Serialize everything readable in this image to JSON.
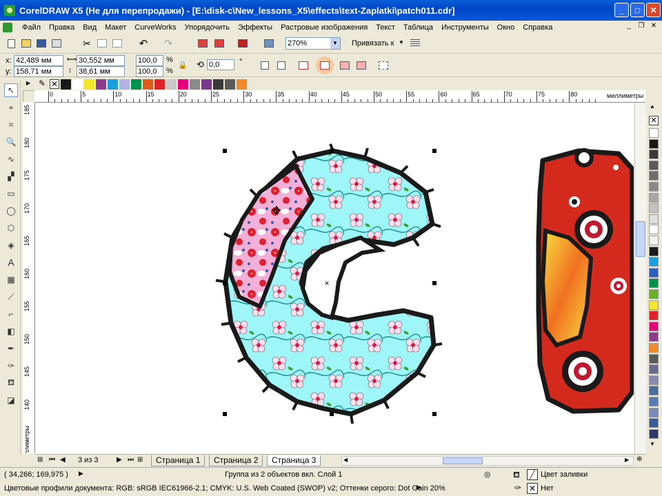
{
  "window": {
    "title": "CorelDRAW X5 (Не для перепродажи) - [E:\\disk-c\\New_lessons_X5\\effects\\text-Zaplatki\\patch011.cdr]"
  },
  "menu": {
    "items": [
      "Файл",
      "Правка",
      "Вид",
      "Макет",
      "CurveWorks",
      "Упорядочить",
      "Эффекты",
      "Растровые изображения",
      "Текст",
      "Таблица",
      "Инструменты",
      "Окно",
      "Справка"
    ]
  },
  "standard_toolbar": {
    "zoom": "270%",
    "snap_label": "Привязать к"
  },
  "property_bar": {
    "x_label": "x:",
    "x_value": "42,489 мм",
    "y_label": "y:",
    "y_value": "158,71 мм",
    "width_value": "30,552 мм",
    "height_value": "38,61 мм",
    "scale_x": "100,0",
    "scale_y": "100,0",
    "percent": "%",
    "rotation": "0,0",
    "degree": "°"
  },
  "palette_top": [
    "#1a1a1a",
    "#ffffff",
    "#f5e62a",
    "#8e3a8e",
    "#1aa0e0",
    "#b2b2e6",
    "#00924a",
    "#e05a1a",
    "#e2202a",
    "#c8c8c8",
    "#e8007a",
    "#8a8a8a",
    "#7a3a8a",
    "#3a3a3a",
    "#5a5a5a",
    "#f08a2a"
  ],
  "palette_right": [
    "#ffffff",
    "#1a1a1a",
    "#3a3a3a",
    "#5a5a5a",
    "#6e6e6e",
    "#8a8a8a",
    "#a6a6a6",
    "#c2c2c2",
    "#dedede",
    "#ffffff",
    "#f0f0f0",
    "#1a1a1a",
    "#1aa0e0",
    "#2a60c0",
    "#00924a",
    "#6ab02a",
    "#f5e62a",
    "#e2202a",
    "#e8007a",
    "#8e3a8e",
    "#f08a2a",
    "#5a5a5a",
    "#6a6a8e",
    "#8a8ab2",
    "#4a6aa0",
    "#5a7ab6",
    "#7a8ab6",
    "#3a5a9a",
    "#2a3a6a"
  ],
  "ruler": {
    "unit": "миллиметры",
    "h_numbers": [
      "0",
      "5",
      "10",
      "15",
      "20",
      "25",
      "30",
      "35",
      "40",
      "45",
      "50",
      "55",
      "60",
      "65",
      "70",
      "75",
      "80"
    ],
    "v_numbers": [
      "185",
      "180",
      "175",
      "170",
      "165",
      "160",
      "155",
      "150",
      "145",
      "140"
    ]
  },
  "page_nav": {
    "counter": "3 из 3",
    "tabs": [
      "Страница 1",
      "Страница 2",
      "Страница 3"
    ]
  },
  "status": {
    "coords": "( 34,266; 169,975 )",
    "selection": "Группа из 2 объектов вкл. Слой 1",
    "color_profiles": "Цветовые профили документа: RGB: sRGB IEC61966-2.1; CMYK: U.S. Web Coated (SWOP) v2; Оттенки серого: Dot Gain 20%",
    "fill_label": "Цвет заливки",
    "outline_label": "Нет"
  },
  "colors": {
    "title_bar": "#0a5fd8",
    "letter_c_fill": "#9ef6f8",
    "pink_patch": "#f2b0d8",
    "red_patch": "#d42a1e",
    "outline": "#1a1a1a"
  }
}
